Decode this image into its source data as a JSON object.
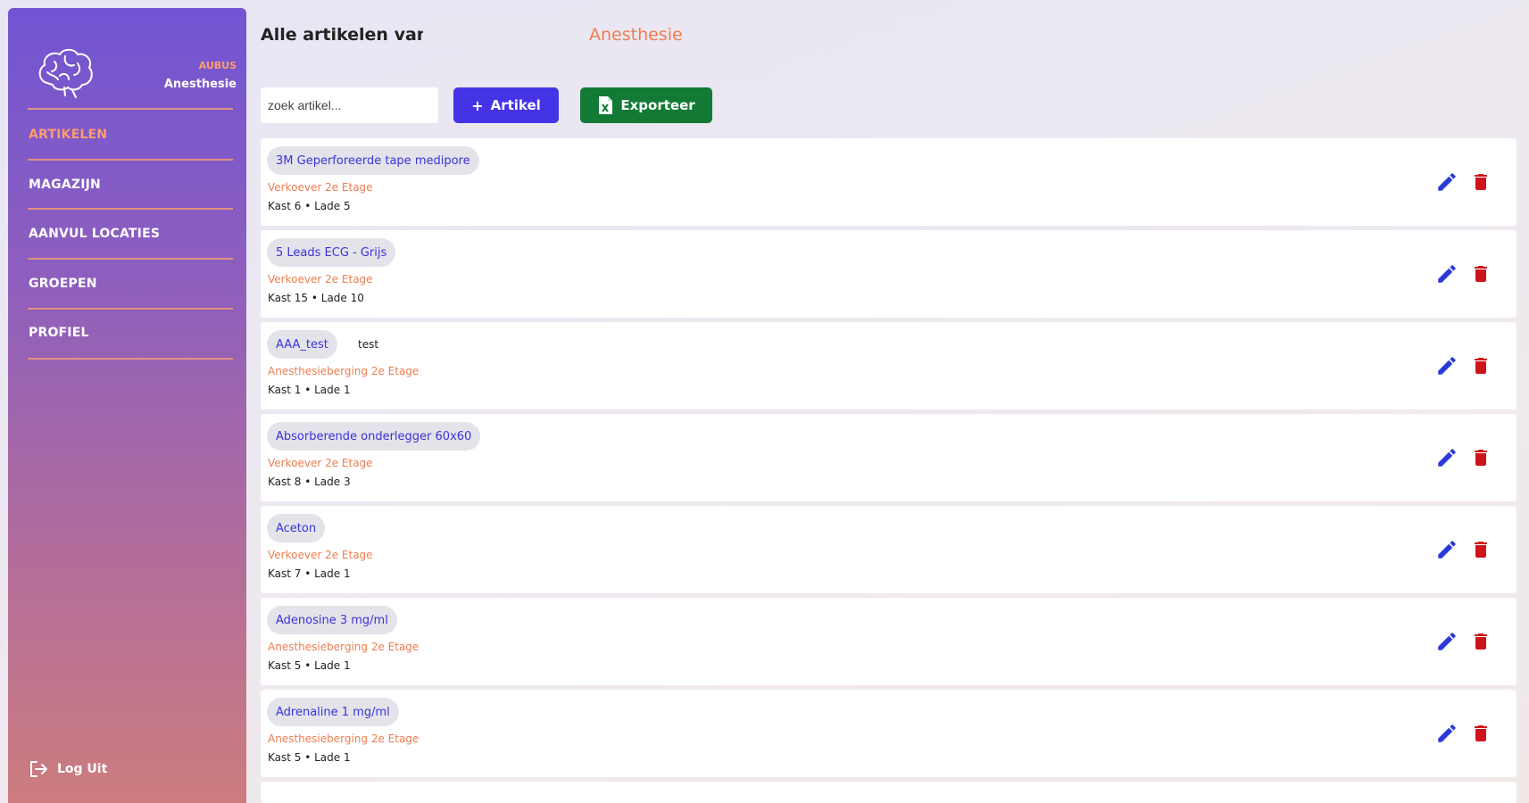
{
  "sidebar": {
    "brand_small": "AUBUS",
    "brand_name": "Anesthesie",
    "nav": [
      {
        "label": "ARTIKELEN",
        "active": true
      },
      {
        "label": "MAGAZIJN",
        "active": false
      },
      {
        "label": "AANVUL LOCATIES",
        "active": false
      },
      {
        "label": "GROEPEN",
        "active": false
      },
      {
        "label": "PROFIEL",
        "active": false
      }
    ],
    "logout_label": "Log Uit"
  },
  "header": {
    "title": "Alle artikelen van",
    "department": "Anesthesie"
  },
  "toolbar": {
    "search_placeholder": "zoek artikel...",
    "add_label": "Artikel",
    "export_label": "Exporteer"
  },
  "articles": [
    {
      "name": "3M Geperforeerde tape medipore",
      "extra": "",
      "location": "Verkoever 2e Etage",
      "position": "Kast 6 • Lade 5"
    },
    {
      "name": "5 Leads ECG - Grijs",
      "extra": "",
      "location": "Verkoever 2e Etage",
      "position": "Kast 15 • Lade 10"
    },
    {
      "name": "AAA_test",
      "extra": "test",
      "location": "Anesthesieberging 2e Etage",
      "position": "Kast 1 • Lade 1"
    },
    {
      "name": "Absorberende onderlegger 60x60",
      "extra": "",
      "location": "Verkoever 2e Etage",
      "position": "Kast 8 • Lade 3"
    },
    {
      "name": "Aceton",
      "extra": "",
      "location": "Verkoever 2e Etage",
      "position": "Kast 7 • Lade 1"
    },
    {
      "name": "Adenosine 3 mg/ml",
      "extra": "",
      "location": "Anesthesieberging 2e Etage",
      "position": "Kast 5 • Lade 1"
    },
    {
      "name": "Adrenaline 1 mg/ml",
      "extra": "",
      "location": "Anesthesieberging 2e Etage",
      "position": "Kast 5 • Lade 1"
    }
  ],
  "colors": {
    "accent_orange": "#ef7d4f",
    "add_button": "#4434e6",
    "export_button": "#127a35",
    "edit_icon": "#2a3ad8",
    "delete_icon": "#d0141c"
  }
}
